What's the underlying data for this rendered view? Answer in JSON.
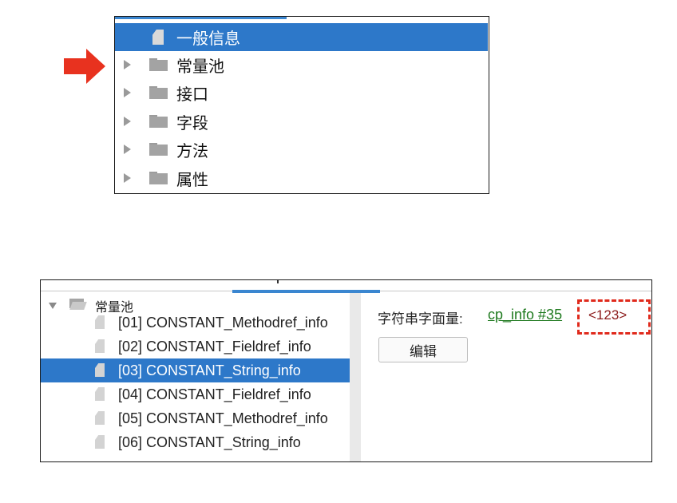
{
  "top_tree": {
    "items": [
      {
        "label": "一般信息",
        "kind": "file",
        "selected": true
      },
      {
        "label": "常量池",
        "kind": "folder",
        "selected": false
      },
      {
        "label": "接口",
        "kind": "folder",
        "selected": false
      },
      {
        "label": "字段",
        "kind": "folder",
        "selected": false
      },
      {
        "label": "方法",
        "kind": "folder",
        "selected": false
      },
      {
        "label": "属性",
        "kind": "folder",
        "selected": false
      }
    ]
  },
  "bottom_tree": {
    "root_label": "常量池",
    "items": [
      {
        "label": "[01] CONSTANT_Methodref_info",
        "selected": false
      },
      {
        "label": "[02] CONSTANT_Fieldref_info",
        "selected": false
      },
      {
        "label": "[03] CONSTANT_String_info",
        "selected": true
      },
      {
        "label": "[04] CONSTANT_Fieldref_info",
        "selected": false
      },
      {
        "label": "[05] CONSTANT_Methodref_info",
        "selected": false
      },
      {
        "label": "[06] CONSTANT_String_info",
        "selected": false
      }
    ]
  },
  "detail": {
    "field_label": "字符串字面量:",
    "link_text": "cp_info #35",
    "value_text": "<123>",
    "edit_button": "编辑"
  },
  "colors": {
    "selection": "#2d78c9",
    "annotation_red": "#e02a1c",
    "link_green": "#1f7a1f"
  }
}
